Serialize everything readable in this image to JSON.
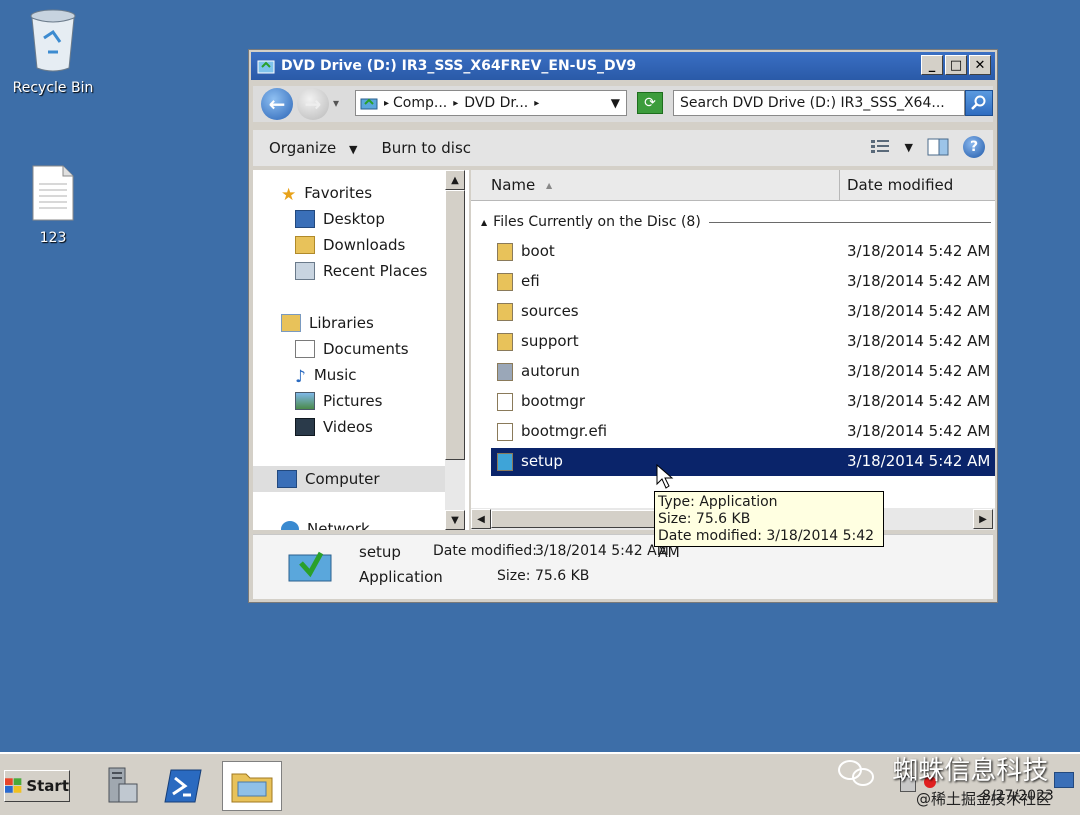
{
  "desktop": {
    "icons": [
      {
        "label": "Recycle Bin",
        "icon": "recycle-bin-icon"
      },
      {
        "label": "123",
        "icon": "text-file-icon"
      }
    ]
  },
  "window": {
    "title": "DVD Drive (D:) IR3_SSS_X64FREV_EN-US_DV9",
    "buttons": {
      "minimize": "_",
      "maximize": "□",
      "close": "✕"
    },
    "address": {
      "crumbs": [
        "Comp...",
        "DVD Dr..."
      ],
      "separator": "▸",
      "dropdown": "▾",
      "main_dropdown": "▼"
    },
    "search": {
      "placeholder": "Search DVD Drive (D:) IR3_SSS_X64..."
    },
    "toolbar": {
      "organize": "Organize",
      "organize_arrow": "▼",
      "burn": "Burn to disc",
      "views_arrow": "▼",
      "help": "?"
    },
    "navpane": {
      "favorites": "Favorites",
      "desktop": "Desktop",
      "downloads": "Downloads",
      "recent": "Recent Places",
      "libraries": "Libraries",
      "documents": "Documents",
      "music": "Music",
      "pictures": "Pictures",
      "videos": "Videos",
      "computer": "Computer",
      "network": "Network"
    },
    "filelist": {
      "columns": {
        "name": "Name",
        "date": "Date modified",
        "sort_arrow": "▲"
      },
      "group": "Files Currently on the Disc (8)",
      "group_arrow": "▲",
      "rows": [
        {
          "name": "boot",
          "date": "3/18/2014 5:42 AM",
          "icon": "folder-icon",
          "color": "#e8c25a"
        },
        {
          "name": "efi",
          "date": "3/18/2014 5:42 AM",
          "icon": "folder-icon",
          "color": "#e8c25a"
        },
        {
          "name": "sources",
          "date": "3/18/2014 5:42 AM",
          "icon": "folder-icon",
          "color": "#e8c25a"
        },
        {
          "name": "support",
          "date": "3/18/2014 5:42 AM",
          "icon": "folder-icon",
          "color": "#e8c25a"
        },
        {
          "name": "autorun",
          "date": "3/18/2014 5:42 AM",
          "icon": "settings-file-icon",
          "color": "#9aa7b8"
        },
        {
          "name": "bootmgr",
          "date": "3/18/2014 5:42 AM",
          "icon": "file-icon",
          "color": "#ffffff"
        },
        {
          "name": "bootmgr.efi",
          "date": "3/18/2014 5:42 AM",
          "icon": "file-icon",
          "color": "#ffffff"
        },
        {
          "name": "setup",
          "date": "3/18/2014 5:42 AM",
          "icon": "setup-app-icon",
          "color": "#3ea4d8"
        }
      ]
    },
    "tooltip": {
      "type": "Type: Application",
      "size": "Size: 75.6 KB",
      "date": "Date modified: 3/18/2014 5:42 AM"
    },
    "details": {
      "name": "setup",
      "type": "Application",
      "date_label": "Date modified:",
      "date_value": "3/18/2014 5:42 AM",
      "size_label": "Size:",
      "size_value": "75.6 KB"
    }
  },
  "taskbar": {
    "start": "Start",
    "tray_date": "8/27/2023"
  },
  "watermark": {
    "line1": "蜘蛛信息科技",
    "line2": "@稀土掘金技术社区"
  },
  "colors": {
    "desktop": "#3d6ea8",
    "titlebar": "#2a5aa8",
    "selection": "#0a246a",
    "tooltip": "#ffffe1"
  }
}
